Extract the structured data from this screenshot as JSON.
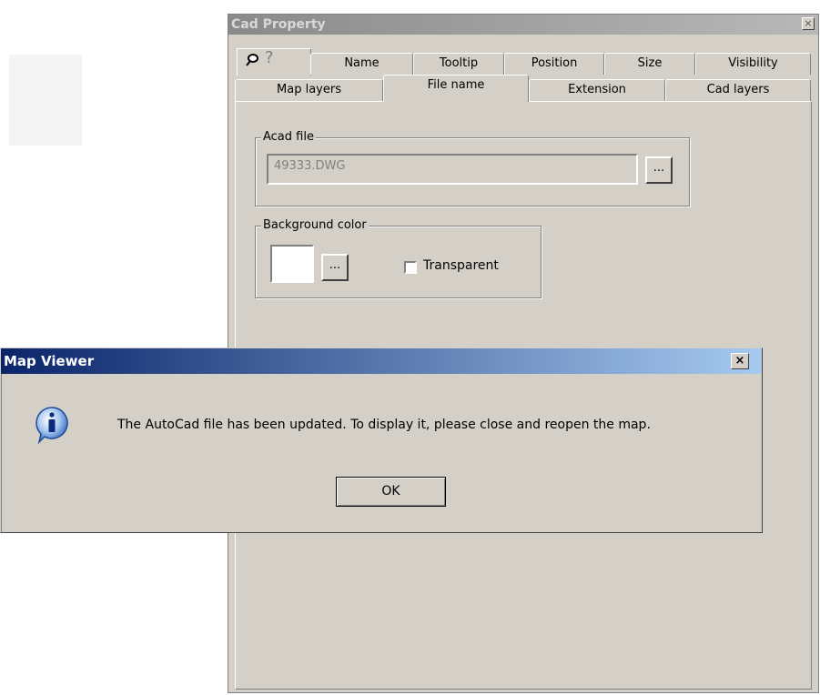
{
  "cad_property": {
    "title": "Cad Property",
    "close_glyph": "×",
    "tabs_row1": [
      {
        "label": "Name"
      },
      {
        "label": "Tooltip"
      },
      {
        "label": "Position"
      },
      {
        "label": "Size"
      },
      {
        "label": "Visibility"
      }
    ],
    "tabs_row2": [
      {
        "label": "Map layers"
      },
      {
        "label": "File name"
      },
      {
        "label": "Extension"
      },
      {
        "label": "Cad layers"
      }
    ],
    "active_tab": "File name",
    "icons": {
      "pin": "pin-icon",
      "help": "help-icon"
    },
    "acad_file": {
      "legend": "Acad file",
      "value": "49333.DWG",
      "browse_label": "..."
    },
    "background_color": {
      "legend": "Background color",
      "browse_label": "...",
      "swatch_color": "#ffffff",
      "transparent_label": "Transparent",
      "transparent_checked": false
    }
  },
  "dialog": {
    "title": "Map Viewer",
    "close_glyph": "×",
    "icon": "info-icon",
    "message": "The AutoCad file has been updated. To display it, please close and reopen the map.",
    "ok_label": "OK"
  },
  "colors": {
    "dialog_title_start": "#0a246a",
    "dialog_title_end": "#a6caf0",
    "window_face": "#d4d0c8"
  }
}
